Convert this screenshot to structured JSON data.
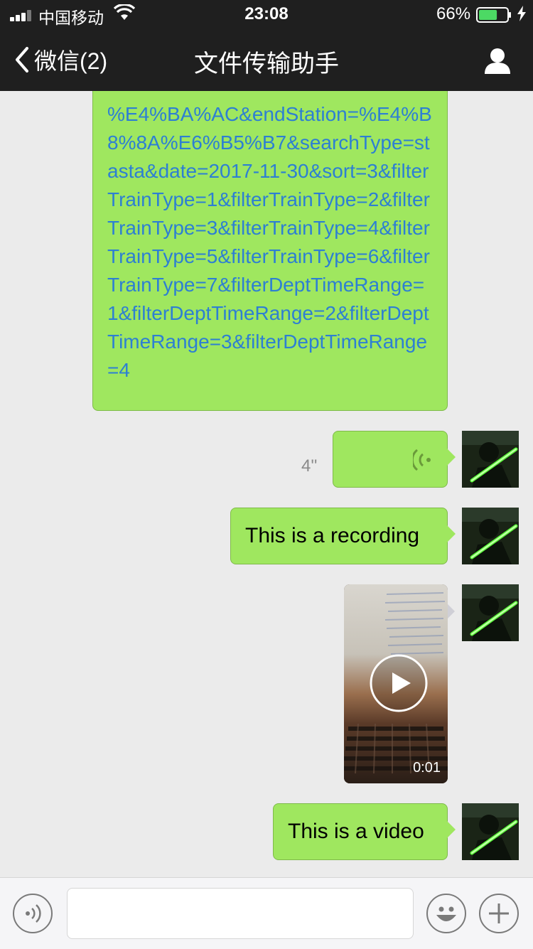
{
  "status_bar": {
    "carrier": "中国移动",
    "time": "23:08",
    "battery_percent": "66%",
    "battery_level": 0.66
  },
  "nav": {
    "back_label": "微信(2)",
    "title": "文件传输助手"
  },
  "messages": {
    "link_text": "%E4%BA%AC&endStation=%E4%B8%8A%E6%B5%B7&searchType=stasta&date=2017-11-30&sort=3&filterTrainType=1&filterTrainType=2&filterTrainType=3&filterTrainType=4&filterTrainType=5&filterTrainType=6&filterTrainType=7&filterDeptTimeRange=1&filterDeptTimeRange=2&filterDeptTimeRange=3&filterDeptTimeRange=4",
    "voice_duration": "4''",
    "recording_text": "This is a recording",
    "video_duration": "0:01",
    "video_caption_text": "This is a video"
  },
  "colors": {
    "bubble": "#9fe75f",
    "link": "#2d7fd3",
    "header": "#1f1f1f",
    "background": "#ebebeb"
  }
}
